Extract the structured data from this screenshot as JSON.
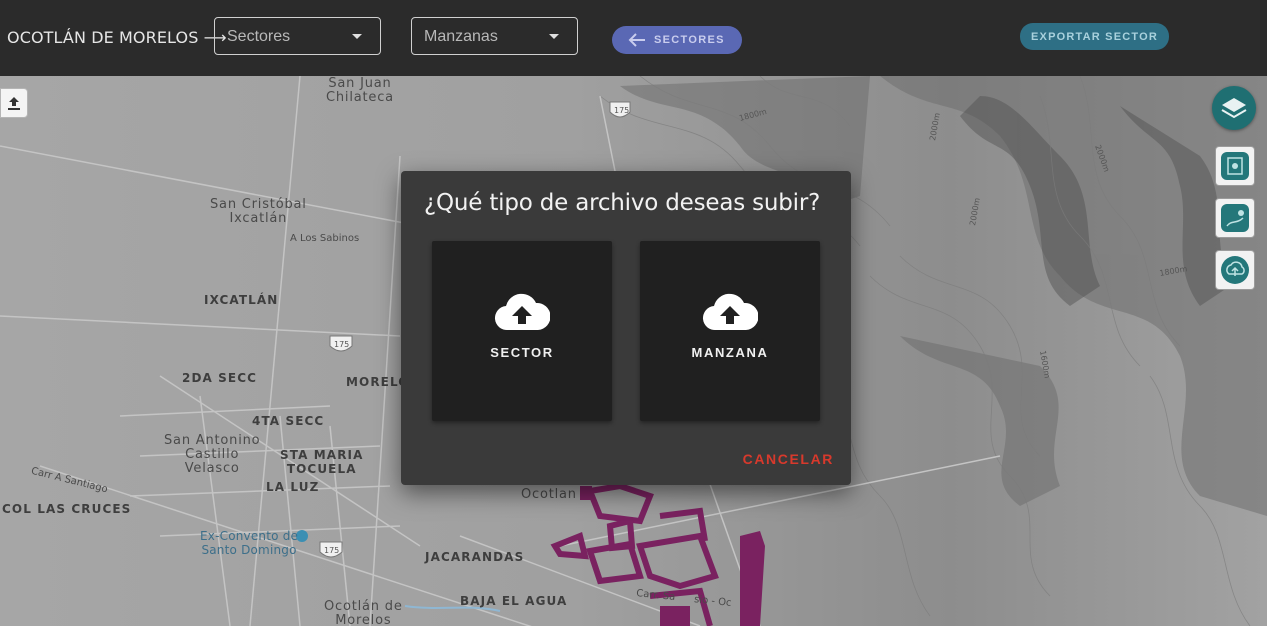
{
  "header": {
    "breadcrumb": "OCOTLÁN DE MORELOS ⟶",
    "sectors_select": "Sectores",
    "blocks_select": "Manzanas",
    "back_button": "SECTORES",
    "export_button": "EXPORTAR SECTOR"
  },
  "map": {
    "places": {
      "san_juan": "San Juan\nChilateca",
      "san_cristobal": "San Cristóbal\nIxcatlán",
      "los_sabinos": "A Los Sabinos",
      "ixcatlan": "IXCATLÁN",
      "segunda_secc": "2DA SECC",
      "morelos": "MORELOS",
      "cuarta_secc": "4TA SECC",
      "san_antonino": "San Antonino\nCastillo\nVelasco",
      "sta_maria": "STA MARIA\nTOCUELA",
      "la_luz": "LA LUZ",
      "carr_santiago": "Carr A Santiago",
      "col_cruces": "COL LAS CRUCES",
      "ex_convento": "Ex-Convento de\nSanto Domingo",
      "ocotlan_mid": "Ocotlan",
      "jacarandas": "JACARANDAS",
      "baja_agua": "BAJA EL AGUA",
      "ocotlan_morelos": "Ocotlán de\nMorelos",
      "carr_sio": "Carr. Sa      sio - Oc"
    },
    "highway_shields": [
      "175",
      "175",
      "175"
    ],
    "contours": [
      "1800m",
      "2000m",
      "2000m",
      "1800m",
      "2000m",
      "1800m",
      "1600m"
    ]
  },
  "dialog": {
    "title": "¿Qué tipo de archivo deseas subir?",
    "options": [
      {
        "label": "SECTOR",
        "icon": "cloud-upload-icon"
      },
      {
        "label": "MANZANA",
        "icon": "cloud-upload-icon"
      }
    ],
    "cancel": "CANCELAR"
  },
  "colors": {
    "topbar": "#2b2b2b",
    "dialog": "#3a3a3a",
    "card": "#202020",
    "cancel": "#d8392c",
    "back_button": "#5a68b4",
    "export_button": "#2e6f85",
    "teal_controls": "#1f6f72",
    "sector_overlay": "#7a2260"
  }
}
